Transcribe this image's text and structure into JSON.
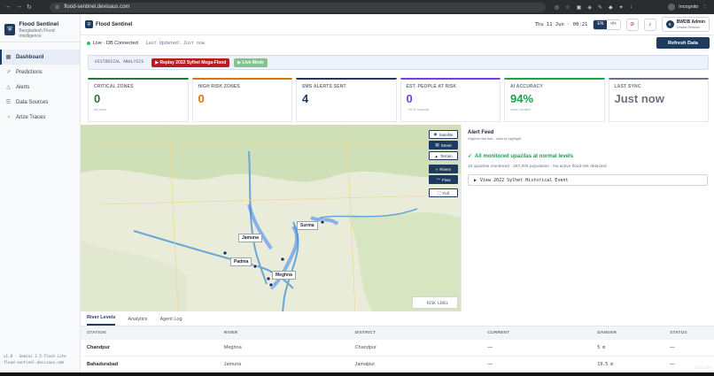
{
  "browser": {
    "url": "flood-sentinel.devisaus.com",
    "incognito_label": "Incognito"
  },
  "sidebar": {
    "brand_title": "Flood Sentinel",
    "brand_subtitle": "Bangladesh Flood Intelligence",
    "items": [
      {
        "label": "Dashboard",
        "icon": "grid-icon",
        "active": true
      },
      {
        "label": "Predictions",
        "icon": "chart-icon",
        "active": false
      },
      {
        "label": "Alerts",
        "icon": "bell-icon",
        "active": false
      },
      {
        "label": "Data Sources",
        "icon": "database-icon",
        "active": false
      },
      {
        "label": "Arize Traces",
        "icon": "trace-icon",
        "active": false
      }
    ],
    "footer_line1": "v1.0 · Gemini 2.5 Flash Lite",
    "footer_line2": "flood-sentinel.devisaus.com"
  },
  "topbar": {
    "title": "Flood Sentinel",
    "clock": "Thu 11 Jun · 00:21",
    "lang_en": "EN",
    "lang_bn": "বাং",
    "user_initial": "B",
    "user_name": "BWDB Admin",
    "user_division": "Dhaka Division"
  },
  "status": {
    "connection": "Live · DB Connected",
    "last_updated": "Last Updated: Just now",
    "refresh_label": "Refresh Data"
  },
  "historical": {
    "label": "HISTORICAL ANALYSIS",
    "replay_label": "Replay 2022 Sylhet Mega-Flood",
    "live_label": "Live Mode"
  },
  "cards": [
    {
      "label": "CRITICAL ZONES",
      "value": "0",
      "sub": "All clear",
      "color": "#1e7a3a"
    },
    {
      "label": "HIGH RISK ZONES",
      "value": "0",
      "sub": "",
      "color": "#d97706"
    },
    {
      "label": "SMS ALERTS SENT",
      "value": "4",
      "sub": "",
      "color": "#1e3a5f"
    },
    {
      "label": "EST. PEOPLE AT RISK",
      "value": "0",
      "sub": "~267K upazila",
      "color": "#7c3aed"
    },
    {
      "label": "AI ACCURACY",
      "value": "94%",
      "sub": "Arize verified",
      "color": "#16a34a"
    },
    {
      "label": "LAST SYNC",
      "value": "Just now",
      "sub": "",
      "color": "#6b7280"
    }
  ],
  "map": {
    "tools": [
      "Satellite",
      "Street",
      "Terrain",
      "Rivers",
      "Flow",
      "Full"
    ],
    "labels": [
      "Jamuna",
      "Surma",
      "Padma",
      "Meghna"
    ],
    "risk_level": "RISK LEVEL"
  },
  "alerts": {
    "title": "Alert Feed",
    "subtitle": "Highest risk first · click to highlight",
    "ok_text": "All monitored upazilas at normal levels",
    "ok_detail": "10 upazilas monitored · 267,000 population · No active flood risk detected",
    "view_label": "View 2022 Sylhet Historical Event"
  },
  "tabs": [
    "River Levels",
    "Analytics",
    "Agent Log"
  ],
  "table": {
    "headers": [
      "STATION",
      "RIVER",
      "DISTRICT",
      "CURRENT",
      "DANGER",
      "STATUS"
    ],
    "rows": [
      [
        "Chandpur",
        "Meghna",
        "Chandpur",
        "—",
        "5 m",
        "—"
      ],
      [
        "Bahadurabad",
        "Jamuna",
        "Jamalpur",
        "—",
        "19.5 m",
        "—"
      ]
    ]
  },
  "taskbar_time": "12:21 AM"
}
